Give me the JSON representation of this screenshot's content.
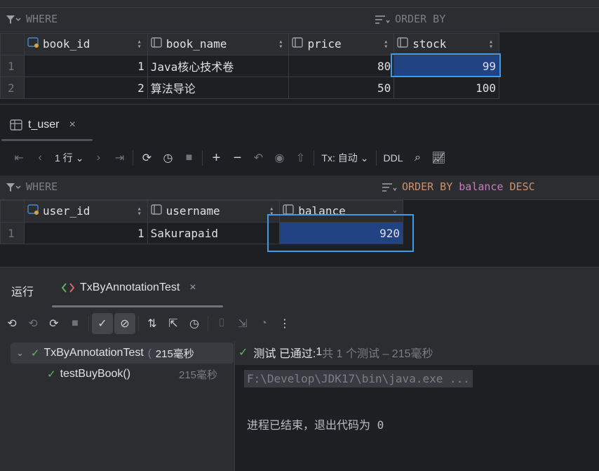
{
  "book_table": {
    "where_label": "WHERE",
    "order_label": "ORDER BY",
    "columns": [
      "book_id",
      "book_name",
      "price",
      "stock"
    ],
    "rows": [
      {
        "n": "1",
        "book_id": "1",
        "book_name": "Java核心技术卷",
        "price": "80",
        "stock": "99"
      },
      {
        "n": "2",
        "book_id": "2",
        "book_name": "算法导论",
        "price": "50",
        "stock": "100"
      }
    ]
  },
  "user_tab": {
    "label": "t_user",
    "close": "×"
  },
  "user_toolbar": {
    "rows_label": "1 行",
    "tx_label": "Tx: 自动",
    "ddl_label": "DDL"
  },
  "user_table": {
    "where_label": "WHERE",
    "order_prefix": "ORDER BY",
    "order_field": "balance",
    "order_dir": "DESC",
    "columns": [
      "user_id",
      "username",
      "balance"
    ],
    "rows": [
      {
        "n": "1",
        "user_id": "1",
        "username": "Sakurapaid",
        "balance": "920"
      }
    ]
  },
  "run_panel": {
    "title": "运行",
    "tab_label": "TxByAnnotationTest",
    "tab_close": "×",
    "tree": [
      {
        "label": "TxByAnnotationTest",
        "time": "215毫秒",
        "paren": "("
      },
      {
        "label": "testBuyBook()",
        "time": "215毫秒"
      }
    ],
    "status_prefix": "测试 已通过: ",
    "status_count": "1",
    "status_suffix": "共 1 个测试 – 215毫秒",
    "console_cmd": "F:\\Develop\\JDK17\\bin\\java.exe ...",
    "console_exit": "进程已结束，退出代码为 0"
  },
  "colors": {
    "accent": "#3d9be9",
    "selection": "#214283",
    "pass": "#5fb865",
    "order_keyword": "#cf8e6d",
    "field": "#c77dbb"
  }
}
